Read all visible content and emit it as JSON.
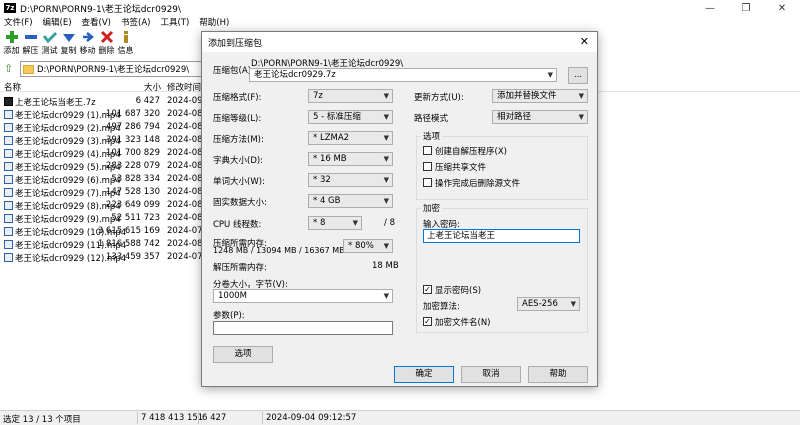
{
  "window": {
    "title": "D:\\PORN\\PORN9-1\\老王论坛dcr0929\\",
    "app_icon": "7z",
    "controls": [
      "—",
      "❐",
      "✕"
    ]
  },
  "menu": [
    "文件(F)",
    "编辑(E)",
    "查看(V)",
    "书签(A)",
    "工具(T)",
    "帮助(H)"
  ],
  "toolbar": [
    {
      "label": "添加",
      "icon": "plus-icon"
    },
    {
      "label": "解压",
      "icon": "minus-icon"
    },
    {
      "label": "测试",
      "icon": "check-icon"
    },
    {
      "label": "复制",
      "icon": "copy-arrow-icon"
    },
    {
      "label": "移动",
      "icon": "move-arrow-icon"
    },
    {
      "label": "删除",
      "icon": "delete-x-icon"
    },
    {
      "label": "信息",
      "icon": "info-icon"
    }
  ],
  "address": "D:\\PORN\\PORN9-1\\老王论坛dcr0929\\",
  "filelist": {
    "headers": {
      "name": "名称",
      "size": "大小",
      "modified": "修改时间"
    },
    "rows": [
      {
        "name": "上老王论坛当老王.7z",
        "size": "6 427",
        "modified": "2024-09-0",
        "archive": true
      },
      {
        "name": "老王论坛dcr0929 (1).mp4",
        "size": "101 687 320",
        "modified": "2024-08-1"
      },
      {
        "name": "老王论坛dcr0929 (2).mp4",
        "size": "497 286 794",
        "modified": "2024-08-1"
      },
      {
        "name": "老王论坛dcr0929 (3).mp4",
        "size": "391 323 148",
        "modified": "2024-08-1"
      },
      {
        "name": "老王论坛dcr0929 (4).mp4",
        "size": "101 700 829",
        "modified": "2024-08-1"
      },
      {
        "name": "老王论坛dcr0929 (5).mp4",
        "size": "283 228 079",
        "modified": "2024-08-1"
      },
      {
        "name": "老王论坛dcr0929 (6).mp4",
        "size": "53 828 334",
        "modified": "2024-08-1"
      },
      {
        "name": "老王论坛dcr0929 (7).mp4",
        "size": "147 528 130",
        "modified": "2024-08-1"
      },
      {
        "name": "老王论坛dcr0929 (8).mp4",
        "size": "223 649 099",
        "modified": "2024-08-1"
      },
      {
        "name": "老王论坛dcr0929 (9).mp4",
        "size": "52 511 723",
        "modified": "2024-08-1"
      },
      {
        "name": "老王论坛dcr0929 (10).mp4",
        "size": "3 615 615 169",
        "modified": "2024-07-2"
      },
      {
        "name": "老王论坛dcr0929 (11).mp4",
        "size": "1 816 588 742",
        "modified": "2024-08-1"
      },
      {
        "name": "老王论坛dcr0929 (12).mp4",
        "size": "133 459 357",
        "modified": "2024-07-2"
      }
    ]
  },
  "status": {
    "selection": "选定 13 / 13 个项目",
    "total": "7 418 413 151",
    "size": "6 427",
    "date": "2024-09-04 09:12:57"
  },
  "dialog": {
    "title": "添加到压缩包",
    "archive_label": "压缩包(A)",
    "archive_path": "D:\\PORN\\PORN9-1\\老王论坛dcr0929\\",
    "archive_name": "老王论坛dcr0929.7z",
    "browse": "...",
    "format_label": "压缩格式(F):",
    "format": "7z",
    "level_label": "压缩等级(L):",
    "level": "5 - 标准压缩",
    "method_label": "压缩方法(M):",
    "method": "* LZMA2",
    "dict_label": "字典大小(D):",
    "dict": "* 16 MB",
    "word_label": "单词大小(W):",
    "word": "* 32",
    "solid_label": "固实数据大小:",
    "solid": "* 4 GB",
    "cpu_label": "CPU 线程数:",
    "cpu": "* 8",
    "cpu_max": "/ 8",
    "mem_comp_label": "压缩所需内存:",
    "mem_comp_detail": "1248 MB / 13094 MB / 16367 MB",
    "mem_comp_pct": "* 80%",
    "mem_decomp_label": "解压所需内存:",
    "mem_decomp": "18 MB",
    "split_label": "分卷大小，字节(V):",
    "split": "1000M",
    "params_label": "参数(P):",
    "params": "",
    "options_button": "选项",
    "update_label": "更新方式(U):",
    "update": "添加并替换文件",
    "pathmode_label": "路径模式",
    "pathmode": "相对路径",
    "options_group": "选项",
    "opt_sfx": "创建自解压程序(X)",
    "opt_shared": "压缩共享文件",
    "opt_delete": "操作完成后删除源文件",
    "encrypt_group": "加密",
    "password_label": "输入密码:",
    "password": "上老王论坛当老王",
    "show_password": "显示密码(S)",
    "enc_method_label": "加密算法:",
    "enc_method": "AES-256",
    "encrypt_names": "加密文件名(N)",
    "ok": "确定",
    "cancel": "取消",
    "help": "帮助"
  }
}
